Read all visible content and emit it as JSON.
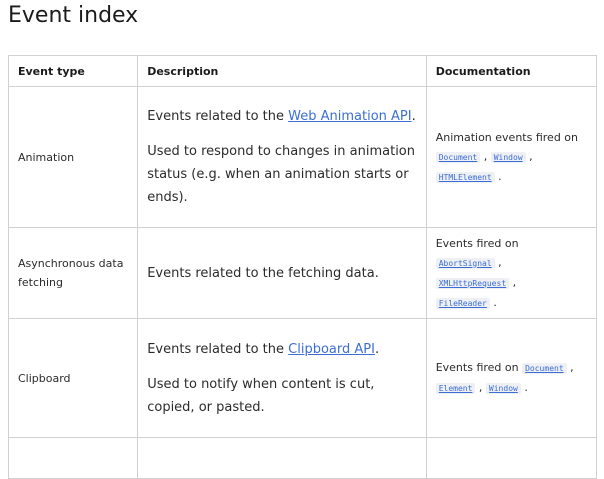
{
  "heading": "Event index",
  "table": {
    "headers": {
      "type": "Event type",
      "description": "Description",
      "documentation": "Documentation"
    },
    "rows": [
      {
        "type": "Animation",
        "desc1_prefix": "Events related to the ",
        "desc1_link": "Web Animation API",
        "desc1_suffix": ".",
        "desc2": "Used to respond to changes in animation status (e.g. when an animation starts or ends).",
        "doc_prefix": "Animation events fired on",
        "doc_items": [
          "Document",
          "Window",
          "HTMLElement"
        ]
      },
      {
        "type": "Asynchronous data fetching",
        "desc1": "Events related to the fetching data.",
        "doc_prefix": "Events fired on",
        "doc_items": [
          "AbortSignal",
          "XMLHttpRequest",
          "FileReader"
        ]
      },
      {
        "type": "Clipboard",
        "desc1_prefix": "Events related to the ",
        "desc1_link": "Clipboard API",
        "desc1_suffix": ".",
        "desc2": "Used to notify when content is cut, copied, or pasted.",
        "doc_prefix": "Events fired on",
        "doc_items": [
          "Document",
          "Element",
          "Window"
        ]
      }
    ]
  }
}
